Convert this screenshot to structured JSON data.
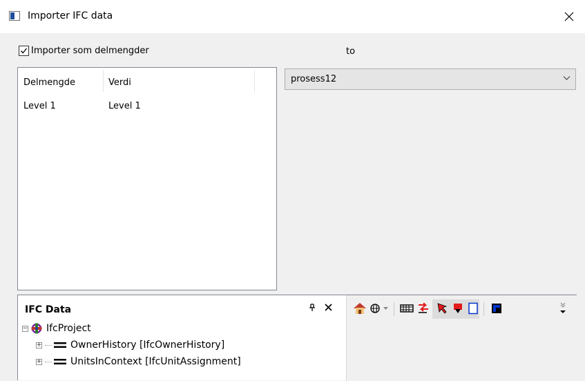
{
  "window": {
    "title": "Importer IFC data",
    "close_icon": "close-icon"
  },
  "options": {
    "import_as_subsets_label": "Importer som delmengder",
    "import_as_subsets_checked": true,
    "to_label": "to"
  },
  "subset_table": {
    "columns": [
      "Delmengde",
      "Verdi"
    ],
    "rows": [
      {
        "subset": "Level 1",
        "value": "Level 1"
      }
    ]
  },
  "target_combo": {
    "value": "prosess12"
  },
  "ifc_panel": {
    "title": "IFC Data",
    "tree": [
      {
        "label": "IfcProject",
        "icon": "ifc-project-icon",
        "expanded": true,
        "level": 0
      },
      {
        "label": "OwnerHistory [IfcOwnerHistory]",
        "icon": "equals-icon",
        "expanded": false,
        "level": 1
      },
      {
        "label": "UnitsInContext [IfcUnitAssignment]",
        "icon": "equals-icon",
        "expanded": false,
        "level": 1
      }
    ]
  },
  "toolbar": {
    "icons": [
      "house-icon",
      "sphere-icon",
      "dropdown-arrow-icon",
      "film-strip-icon",
      "red-arrows-icon",
      "select-pointer-icon",
      "red-down-arrow-icon",
      "rectangle-icon",
      "blue-corner-icon",
      "overflow-chevron-icon"
    ],
    "colors": {
      "accent_red": "#e31b1b",
      "accent_blue": "#0033cc",
      "house_orange": "#d2691e"
    }
  }
}
